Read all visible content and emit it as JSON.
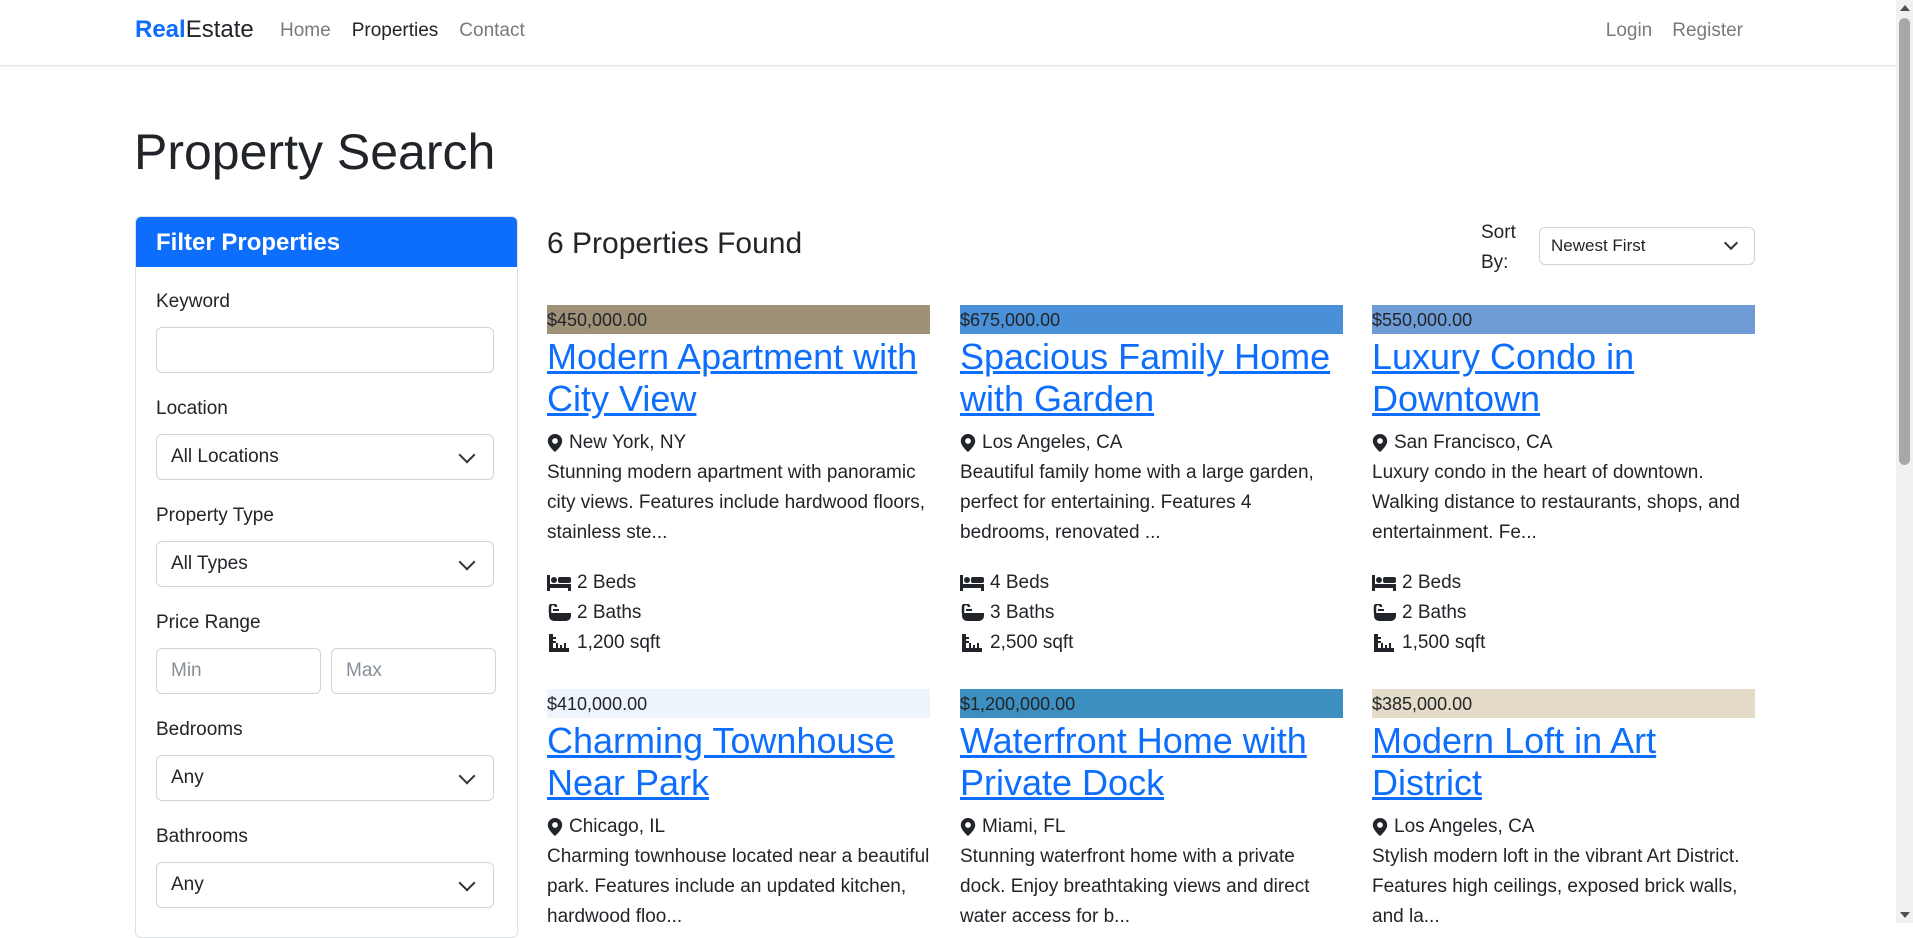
{
  "nav": {
    "brand_primary": "Real",
    "brand_secondary": "Estate",
    "links": [
      "Home",
      "Properties",
      "Contact"
    ],
    "active": "Properties",
    "auth": [
      "Login",
      "Register"
    ]
  },
  "page_title": "Property Search",
  "filter": {
    "header": "Filter Properties",
    "keyword_label": "Keyword",
    "keyword_value": "",
    "location_label": "Location",
    "location_value": "All Locations",
    "type_label": "Property Type",
    "type_value": "All Types",
    "price_label": "Price Range",
    "price_min_placeholder": "Min",
    "price_max_placeholder": "Max",
    "bedrooms_label": "Bedrooms",
    "bedrooms_value": "Any",
    "bathrooms_label": "Bathrooms",
    "bathrooms_value": "Any"
  },
  "results": {
    "count_text": "6 Properties Found",
    "sort_label": "Sort By:",
    "sort_value": "Newest First"
  },
  "colors": {
    "accent": "#0d6efd",
    "banner_1": "#9e9178",
    "banner_2": "#4a90d9",
    "banner_3": "#6f9bd6",
    "banner_4": "#eef4fb",
    "banner_5": "#3d8fbf",
    "banner_6": "#e4dcc8"
  },
  "properties": [
    {
      "price": "$450,000.00",
      "title": "Modern Apartment with City View",
      "location": "New York, NY",
      "description": "Stunning modern apartment with panoramic city views. Features include hardwood floors, stainless ste...",
      "beds": "2 Beds",
      "baths": "2 Baths",
      "sqft": "1,200 sqft"
    },
    {
      "price": "$675,000.00",
      "title": "Spacious Family Home with Garden",
      "location": "Los Angeles, CA",
      "description": "Beautiful family home with a large garden, perfect for entertaining. Features 4 bedrooms, renovated ...",
      "beds": "4 Beds",
      "baths": "3 Baths",
      "sqft": "2,500 sqft"
    },
    {
      "price": "$550,000.00",
      "title": "Luxury Condo in Downtown",
      "location": "San Francisco, CA",
      "description": "Luxury condo in the heart of downtown. Walking distance to restaurants, shops, and entertainment. Fe...",
      "beds": "2 Beds",
      "baths": "2 Baths",
      "sqft": "1,500 sqft"
    },
    {
      "price": "$410,000.00",
      "title": "Charming Townhouse Near Park",
      "location": "Chicago, IL",
      "description": "Charming townhouse located near a beautiful park. Features include an updated kitchen, hardwood floo...",
      "beds": "",
      "baths": "",
      "sqft": ""
    },
    {
      "price": "$1,200,000.00",
      "title": "Waterfront Home with Private Dock",
      "location": "Miami, FL",
      "description": "Stunning waterfront home with a private dock. Enjoy breathtaking views and direct water access for b...",
      "beds": "",
      "baths": "",
      "sqft": ""
    },
    {
      "price": "$385,000.00",
      "title": "Modern Loft in Art District",
      "location": "Los Angeles, CA",
      "description": "Stylish modern loft in the vibrant Art District. Features high ceilings, exposed brick walls, and la...",
      "beds": "",
      "baths": "",
      "sqft": ""
    }
  ]
}
